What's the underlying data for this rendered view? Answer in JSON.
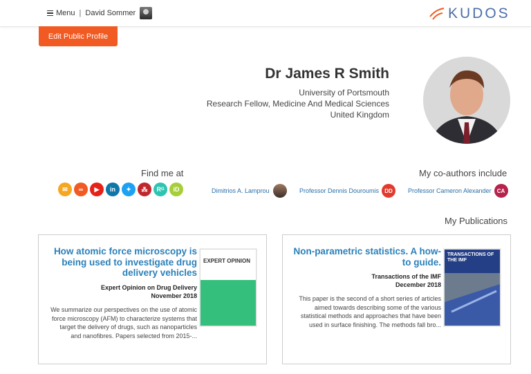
{
  "header": {
    "logo_text": "KUDOS",
    "user_name": "David Sommer",
    "menu_label": "Menu",
    "separator": "|"
  },
  "edit_button": "Edit Public Profile",
  "profile": {
    "name": "Dr James R Smith",
    "institution": "University of Portsmouth",
    "position": "Research Fellow, Medicine And Medical Sciences",
    "country": "United Kingdom"
  },
  "coauthors": {
    "title": "My co-authors include",
    "items": [
      {
        "initials": "CA",
        "name": "Professor Cameron Alexander",
        "color": "#b5224c"
      },
      {
        "initials": "DD",
        "name": "Professor Dennis Douroumis",
        "color": "#e23b2e"
      },
      {
        "initials": "",
        "name": "Dimitrios A. Lamprou",
        "color": ""
      }
    ]
  },
  "find_me": {
    "title": "Find me at",
    "icons": [
      {
        "name": "email-icon",
        "glyph": "✉",
        "color": "#f5a623"
      },
      {
        "name": "link-icon",
        "glyph": "∞",
        "color": "#f15a22"
      },
      {
        "name": "youtube-icon",
        "glyph": "▶",
        "color": "#e62117"
      },
      {
        "name": "linkedin-icon",
        "glyph": "in",
        "color": "#0e76a8"
      },
      {
        "name": "twitter-icon",
        "glyph": "✦",
        "color": "#1da1f2"
      },
      {
        "name": "network-icon",
        "glyph": "⁂",
        "color": "#c0272d"
      },
      {
        "name": "researchgate-icon",
        "glyph": "Rᴳ",
        "color": "#2fc4b2"
      },
      {
        "name": "orcid-icon",
        "glyph": "iD",
        "color": "#a6ce39"
      }
    ]
  },
  "publications": {
    "title": "My Publications",
    "items": [
      {
        "title": "Non-parametric statistics. A how-to guide.",
        "journal": "Transactions of the IMF",
        "date": "December 2018",
        "abstract": "This paper is the second of a short series of articles aimed towards describing some of the various statistical methods and approaches that have been used in surface finishing. The methods fall bro...",
        "cover_text": "TRANSACTIONS OF THE IMF"
      },
      {
        "title": "How atomic force microscopy is being used to investigate drug delivery vehicles",
        "journal": "Expert Opinion on Drug Delivery",
        "date": "November 2018",
        "abstract": "We summarize our perspectives on the use of atomic force microscopy (AFM) to characterize systems that target the delivery of drugs, such as nanoparticles and nanofibres. Papers selected from 2015-...",
        "cover_text": "EXPERT OPINION"
      }
    ]
  }
}
